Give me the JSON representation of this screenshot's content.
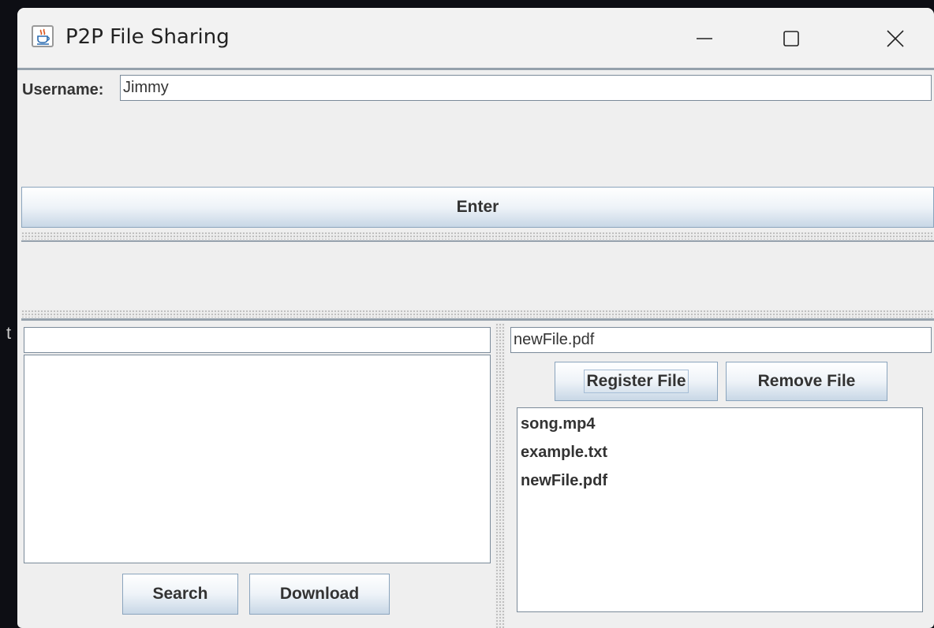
{
  "desktop": {
    "edge_glyph": "t"
  },
  "window": {
    "title": "P2P File Sharing",
    "icon": "java-cup-icon",
    "controls": {
      "minimize": "minimize-icon",
      "maximize": "maximize-icon",
      "close": "close-icon"
    }
  },
  "login": {
    "username_label": "Username:",
    "username_value": "Jimmy",
    "enter_label": "Enter"
  },
  "search_panel": {
    "query_value": "",
    "search_label": "Search",
    "download_label": "Download"
  },
  "files_panel": {
    "file_input_value": "newFile.pdf",
    "register_label": "Register File",
    "remove_label": "Remove File",
    "files": [
      "song.mp4",
      "example.txt",
      "newFile.pdf"
    ]
  },
  "colors": {
    "window_bg": "#efefef",
    "button_border": "#8aa4bd",
    "separator": "#95a1ac",
    "desktop": "#0d0e14"
  }
}
